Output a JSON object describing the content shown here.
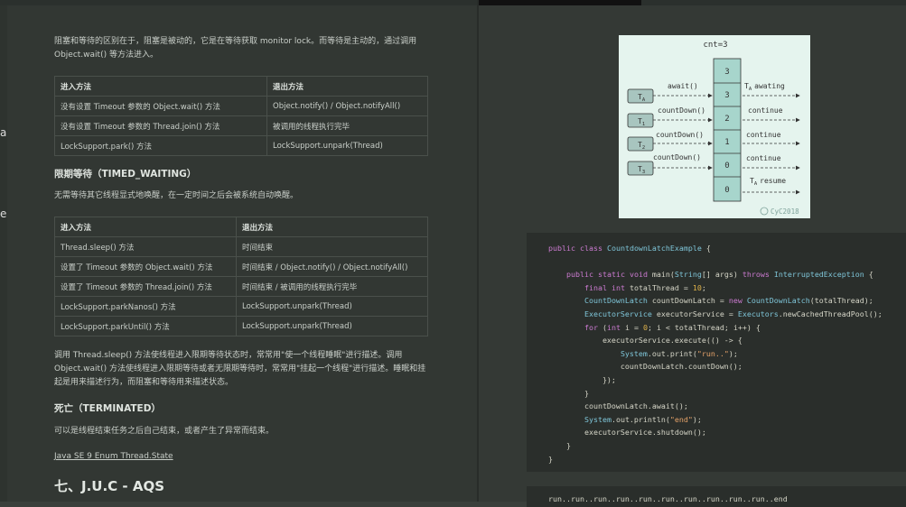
{
  "left_page": {
    "intro_line1": "阻塞和等待的区别在于，阻塞是被动的，它是在等待获取 monitor lock。而等待是主动的，通过调用",
    "intro_line2": "Object.wait() 等方法进入。",
    "table1": {
      "headers": [
        "进入方法",
        "退出方法"
      ],
      "rows": [
        [
          "没有设置 Timeout 参数的 Object.wait() 方法",
          "Object.notify() / Object.notifyAll()"
        ],
        [
          "没有设置 Timeout 参数的 Thread.join() 方法",
          "被调用的线程执行完毕"
        ],
        [
          "LockSupport.park() 方法",
          "LockSupport.unpark(Thread)"
        ]
      ]
    },
    "timed_heading": "限期等待（TIMED_WAITING）",
    "timed_desc": "无需等待其它线程显式地唤醒，在一定时间之后会被系统自动唤醒。",
    "table2": {
      "headers": [
        "进入方法",
        "退出方法"
      ],
      "rows": [
        [
          "Thread.sleep() 方法",
          "时间结束"
        ],
        [
          "设置了 Timeout 参数的 Object.wait() 方法",
          "时间结束 / Object.notify() / Object.notifyAll()"
        ],
        [
          "设置了 Timeout 参数的 Thread.join() 方法",
          "时间结束 / 被调用的线程执行完毕"
        ],
        [
          "LockSupport.parkNanos() 方法",
          "LockSupport.unpark(Thread)"
        ],
        [
          "LockSupport.parkUntil() 方法",
          "LockSupport.unpark(Thread)"
        ]
      ]
    },
    "para_line1": "调用 Thread.sleep() 方法使线程进入限期等待状态时，常常用\"使一个线程睡眠\"进行描述。调用",
    "para_line2": "Object.wait() 方法使线程进入限期等待或者无限期等待时，常常用\"挂起一个线程\"进行描述。睡眠和挂",
    "para_line3": "起是用来描述行为，而阻塞和等待用来描述状态。",
    "dead_heading": "死亡（TERMINATED）",
    "dead_desc": "可以是线程结束任务之后自己结束，或者产生了异常而结束。",
    "link": "Java SE 9 Enum Thread.State",
    "section_heading": "七、J.U.C - AQS",
    "edge_frag1": "a",
    "edge_frag2": "e"
  },
  "diagram": {
    "title": "cnt=3",
    "cells": [
      "3",
      "3",
      "2",
      "1",
      "0",
      "0"
    ],
    "threads": [
      "T",
      "T",
      "T",
      "T"
    ],
    "thread_subs": [
      "A",
      "1",
      "2",
      "3"
    ],
    "left_labels": [
      "await()",
      "countDown()",
      "countDown()",
      "countDown()"
    ],
    "right_labels": [
      "awating",
      "continue",
      "continue",
      "continue",
      "resume"
    ],
    "right_prefix": "T",
    "right_prefix_sub": "A",
    "watermark": "CyC2018",
    "colors": {
      "bg": "#e5f4ee",
      "cell": "#a7d5cc",
      "thread": "#a8c5bf",
      "stroke": "#333333"
    }
  },
  "code": {
    "lines": [
      "public class CountdownLatchExample {",
      "",
      "    public static void main(String[] args) throws InterruptedException {",
      "        final int totalThread = 10;",
      "        CountDownLatch countDownLatch = new CountDownLatch(totalThread);",
      "        ExecutorService executorService = Executors.newCachedThreadPool();",
      "        for (int i = 0; i < totalThread; i++) {",
      "            executorService.execute(() -> {",
      "                System.out.print(\"run..\");",
      "                countDownLatch.countDown();",
      "            });",
      "        }",
      "        countDownLatch.await();",
      "        System.out.println(\"end\");",
      "        executorService.shutdown();",
      "    }",
      "}"
    ]
  },
  "output": {
    "text": "run..run..run..run..run..run..run..run..run..run..end"
  }
}
